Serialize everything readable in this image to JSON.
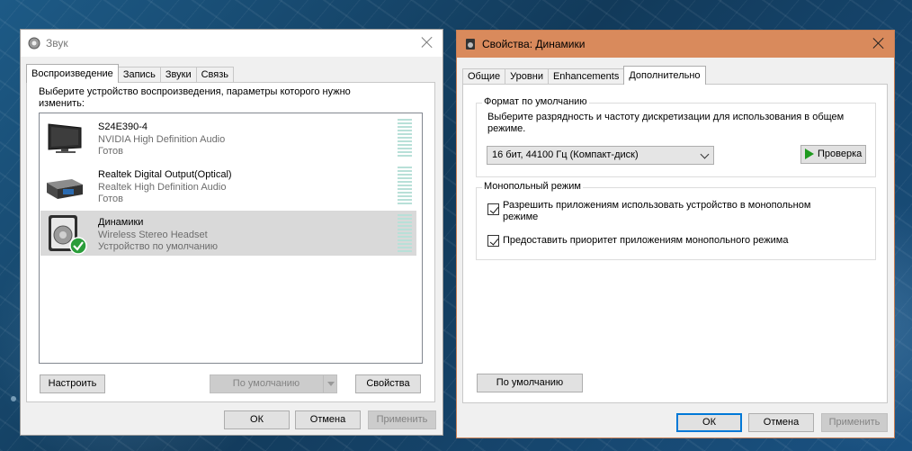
{
  "sound_window": {
    "title": "Звук",
    "tabs": [
      "Воспроизведение",
      "Запись",
      "Звуки",
      "Связь"
    ],
    "instruction": "Выберите устройство воспроизведения, параметры которого нужно изменить:",
    "devices": [
      {
        "name": "S24E390-4",
        "driver": "NVIDIA High Definition Audio",
        "status": "Готов",
        "icon": "monitor-icon"
      },
      {
        "name": "Realtek Digital Output(Optical)",
        "driver": "Realtek High Definition Audio",
        "status": "Готов",
        "icon": "optical-output-icon"
      },
      {
        "name": "Динамики",
        "driver": "Wireless Stereo Headset",
        "status": "Устройство по умолчанию",
        "icon": "speaker-icon",
        "default_badge_icon": "green-check-icon"
      }
    ],
    "configure_label": "Настроить",
    "set_default_label": "По умолчанию",
    "properties_label": "Свойства",
    "ok_label": "ОК",
    "cancel_label": "Отмена",
    "apply_label": "Применить"
  },
  "props_window": {
    "title": "Свойства: Динамики",
    "tabs": [
      "Общие",
      "Уровни",
      "Enhancements",
      "Дополнительно"
    ],
    "format_group_label": "Формат по умолчанию",
    "format_description": "Выберите разрядность и частоту дискретизации для использования в общем режиме.",
    "format_value": "16 бит, 44100 Гц (Компакт-диск)",
    "test_label": "Проверка",
    "exclusive_group_label": "Монопольный режим",
    "allow_exclusive_label": "Разрешить приложениям использовать устройство в монопольном режиме",
    "allow_exclusive_checked": true,
    "priority_label": "Предоставить приоритет приложениям монопольного режима",
    "priority_checked": true,
    "restore_default_label": "По умолчанию",
    "ok_label": "ОК",
    "cancel_label": "Отмена",
    "apply_label": "Применить"
  },
  "colors": {
    "accent": "#0078d7",
    "props_titlebar": "#d98a5c",
    "selection": "#d9d9d9",
    "desktop": "#17476b"
  }
}
